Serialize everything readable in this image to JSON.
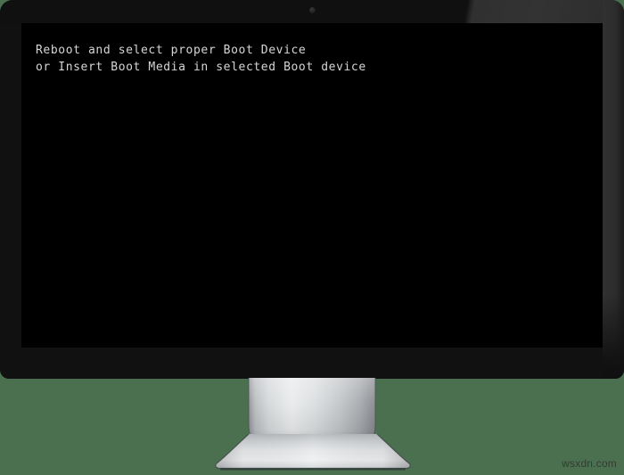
{
  "background": {
    "color": "#4a7050"
  },
  "monitor": {
    "device_name": "desktop-monitor",
    "bezel_color": "#111112",
    "bezel_highlight_color": "#333334",
    "camera": {
      "label": "webcam-indicator"
    },
    "stand": {
      "label": "monitor-stand",
      "material_color": "#c9cbcd"
    }
  },
  "screen": {
    "background_color": "#000000",
    "text_color": "#d6d6d6",
    "message_lines": [
      "Reboot and select proper Boot Device",
      "or Insert Boot Media in selected Boot device"
    ],
    "message_block": "Reboot and select proper Boot Device\nor Insert Boot Media in selected Boot device"
  },
  "watermark": {
    "text": "wsxdn.com",
    "color": "#2f2f2f"
  }
}
